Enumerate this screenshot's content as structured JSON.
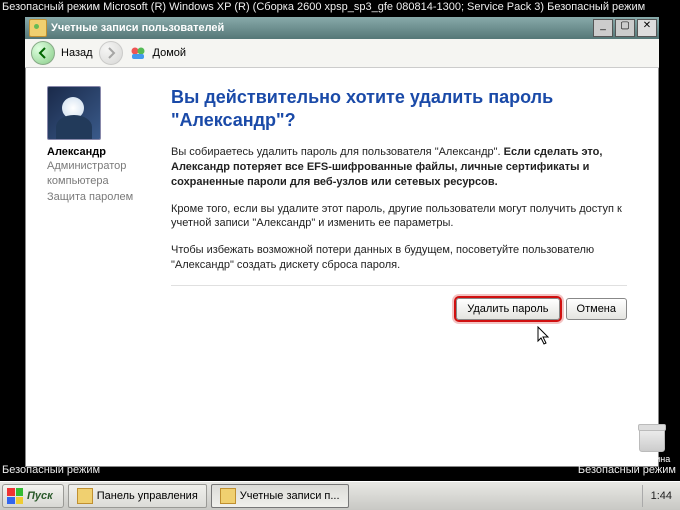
{
  "safemode": {
    "top_left": "Безопасный режим Microsoft (R) Windows XP (R) (Сборка 2600 xpsp_sp3_gfe 080814-1300; Service Pack 3) Безопасный режим",
    "bottom_left": "Безопасный режим",
    "bottom_right": "Безопасный режим"
  },
  "desktop": {
    "recycle_label": "Корзина"
  },
  "window": {
    "title": "Учетные записи пользователей",
    "controls": {
      "min": "_",
      "max": "▢",
      "close": "✕"
    }
  },
  "toolbar": {
    "back_label": "Назад",
    "home_label": "Домой"
  },
  "user": {
    "name": "Александр",
    "role_line1": "Администратор",
    "role_line2": "компьютера",
    "role_line3": "Защита паролем"
  },
  "content": {
    "heading": "Вы действительно хотите удалить пароль \"Александр\"?",
    "p1a": "Вы собираетесь удалить пароль для пользователя \"Александр\". ",
    "p1b": "Если сделать это, Александр потеряет все EFS-шифрованные файлы, личные сертификаты и сохраненные пароли для веб-узлов или сетевых ресурсов.",
    "p2": "Кроме того, если вы удалите этот пароль, другие пользователи могут получить доступ к учетной записи \"Александр\" и изменить ее параметры.",
    "p3": "Чтобы избежать возможной потери данных в будущем, посоветуйте пользователю \"Александр\" создать дискету сброса пароля."
  },
  "buttons": {
    "primary": "Удалить пароль",
    "cancel": "Отмена"
  },
  "taskbar": {
    "start": "Пуск",
    "items": [
      {
        "label": "Панель управления"
      },
      {
        "label": "Учетные записи п..."
      }
    ],
    "clock": "1:44"
  }
}
